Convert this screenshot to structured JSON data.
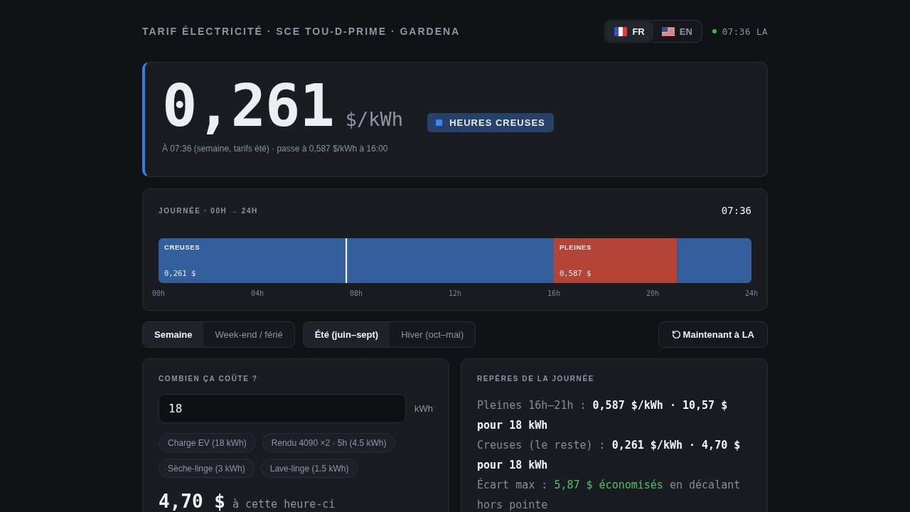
{
  "header": {
    "title": "**TARIF ÉLECTRICITÉ** · SCE TOU-D-PRIME · GARDENA",
    "languages": [
      {
        "code": "FR",
        "kind": "france",
        "selected": true
      },
      {
        "code": "EN",
        "kind": "usa",
        "selected": false
      }
    ],
    "status": {
      "live": true,
      "text": "07:36 LA"
    }
  },
  "hero": {
    "price": "0,261",
    "unit": "$/kWh",
    "badge": {
      "kind": "off_peak",
      "text": "HEURES CREUSES"
    },
    "note": "À 07:36 (semaine, tarifs été) · passe à 0,587 $/kWh à 16:00"
  },
  "timeline": {
    "title": "JOURNÉE · 00H → 24H",
    "now": "07:36",
    "chart_data": {
      "type": "bar",
      "orientation": "horizontal",
      "stacked": true,
      "xlim": [
        0,
        24
      ],
      "xticks": [
        {
          "value": 0,
          "label": "00h"
        },
        {
          "value": 4,
          "label": "04h"
        },
        {
          "value": 8,
          "label": "08h"
        },
        {
          "value": 12,
          "label": "12h"
        },
        {
          "value": 16,
          "label": "16h"
        },
        {
          "value": 20,
          "label": "20h"
        },
        {
          "value": 24,
          "label": "24h"
        }
      ],
      "series": [
        {
          "color": "#33609d",
          "values": [
            16
          ]
        },
        {
          "color": "#b44536",
          "values": [
            5
          ]
        },
        {
          "color": "#33609d",
          "values": [
            3
          ]
        }
      ],
      "value_labels": [
        "0,261 $",
        "0,587 $",
        null
      ],
      "annotations": [
        {
          "x": 0,
          "text": "CREUSES"
        },
        {
          "x": 16,
          "text": "PLEINES"
        }
      ],
      "ref_lines": [
        {
          "axis": "x",
          "value": 7.6
        }
      ]
    }
  },
  "controls": {
    "day_types": [
      {
        "label": "Semaine",
        "selected": true
      },
      {
        "label": "Week-end / férié",
        "selected": false
      }
    ],
    "seasons": [
      {
        "label": "Été (juin–sept)",
        "selected": true
      },
      {
        "label": "Hiver (oct–mai)",
        "selected": false
      }
    ],
    "reset_button": "Maintenant à LA"
  },
  "calculator": {
    "title": "COMBIEN ÇA COÛTE ?",
    "input": {
      "value": "18",
      "unit": "kWh"
    },
    "presets": [
      "Charge EV (18 kWh)",
      "Rendu 4090 ×2 · 5h (4.5 kWh)",
      "Sèche-linge (3 kWh)",
      "Lave-linge (1.5 kWh)"
    ],
    "result": {
      "amount": "4,70 $",
      "caption": "à cette heure-ci"
    }
  },
  "highlights": {
    "title": "REPÈRES DE LA JOURNÉE",
    "lines": [
      {
        "kind": "rate",
        "label": "Pleines 16h–21h :",
        "value": "0,587 $/kWh · 10,57 $ pour 18 kWh"
      },
      {
        "kind": "rate",
        "label": "Creuses (le reste) :",
        "value": "0,261 $/kWh · 4,70 $ pour 18 kWh"
      },
      {
        "kind": "savings",
        "label": "Écart max :",
        "value": "5,87 $ économisés",
        "suffix": "en décalant hors pointe"
      }
    ]
  }
}
